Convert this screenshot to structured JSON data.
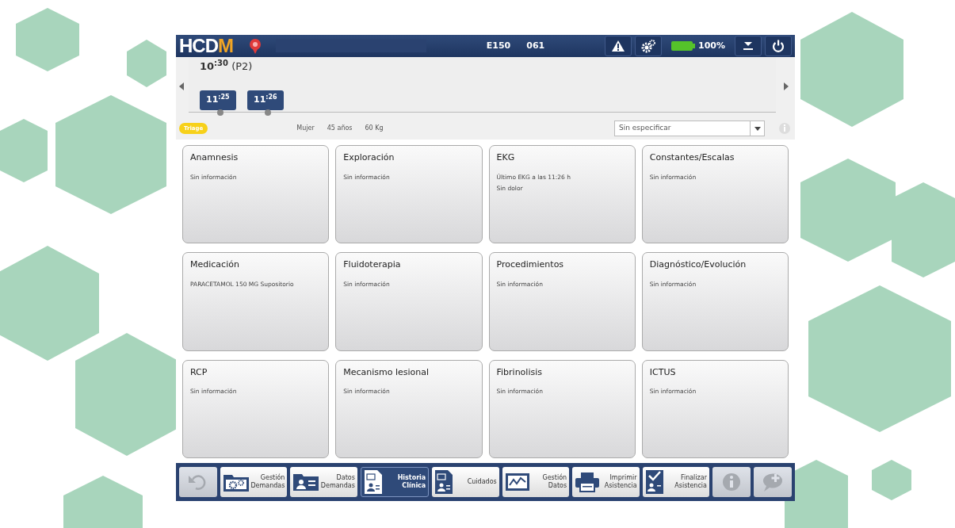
{
  "header": {
    "logo": "HCD",
    "logo_accent": "M",
    "unit": "E150",
    "code": "061",
    "battery_text": "100%"
  },
  "timeline": {
    "current": {
      "hour": "10",
      "minutes": ":30",
      "label": "(P2)"
    },
    "markers": [
      {
        "hour": "11",
        "minutes": ":25"
      },
      {
        "hour": "11",
        "minutes": ":26"
      }
    ]
  },
  "patient": {
    "triage": "Triage",
    "sex": "Mujer",
    "age": "45",
    "age_unit": "años",
    "weight": "60",
    "weight_unit": "Kg",
    "select_value": "Sin especificar"
  },
  "cards": [
    {
      "title": "Anamnesis",
      "lines": [
        "Sin información"
      ]
    },
    {
      "title": "Exploración",
      "lines": [
        "Sin información"
      ]
    },
    {
      "title": "EKG",
      "lines": [
        "Último EKG a las 11:26 h",
        "Sin dolor"
      ]
    },
    {
      "title": "Constantes/Escalas",
      "lines": [
        "Sin información"
      ]
    },
    {
      "title": "Medicación",
      "lines": [
        "PARACETAMOL 150 MG Supositorio"
      ]
    },
    {
      "title": "Fluidoterapia",
      "lines": [
        "Sin información"
      ]
    },
    {
      "title": "Procedimientos",
      "lines": [
        "Sin información"
      ]
    },
    {
      "title": "Diagnóstico/Evolución",
      "lines": [
        "Sin información"
      ]
    },
    {
      "title": "RCP",
      "lines": [
        "Sin información"
      ]
    },
    {
      "title": "Mecanismo lesional",
      "lines": [
        "Sin información"
      ]
    },
    {
      "title": "Fibrinolisis",
      "lines": [
        "Sin información"
      ]
    },
    {
      "title": "ICTUS",
      "lines": [
        "Sin información"
      ]
    }
  ],
  "toolbar": [
    {
      "kind": "icon",
      "selected": false,
      "disabled": true
    },
    {
      "kind": "labeled",
      "lines": [
        "Gestión",
        "Demandas"
      ],
      "selected": false,
      "disabled": false
    },
    {
      "kind": "labeled",
      "lines": [
        "Datos",
        "Demandas"
      ],
      "selected": false,
      "disabled": false
    },
    {
      "kind": "labeled",
      "lines": [
        "Historia",
        "Clínica"
      ],
      "selected": true,
      "disabled": false
    },
    {
      "kind": "labeled",
      "lines": [
        "Cuidados"
      ],
      "selected": false,
      "disabled": false
    },
    {
      "kind": "labeled",
      "lines": [
        "Gestión",
        "Datos"
      ],
      "selected": false,
      "disabled": false
    },
    {
      "kind": "labeled",
      "lines": [
        "Imprimir",
        "Asistencia"
      ],
      "selected": false,
      "disabled": false
    },
    {
      "kind": "labeled",
      "lines": [
        "Finalizar",
        "Asistencia"
      ],
      "selected": false,
      "disabled": false
    },
    {
      "kind": "icon",
      "selected": false,
      "disabled": true
    },
    {
      "kind": "icon",
      "selected": false,
      "disabled": true
    }
  ]
}
